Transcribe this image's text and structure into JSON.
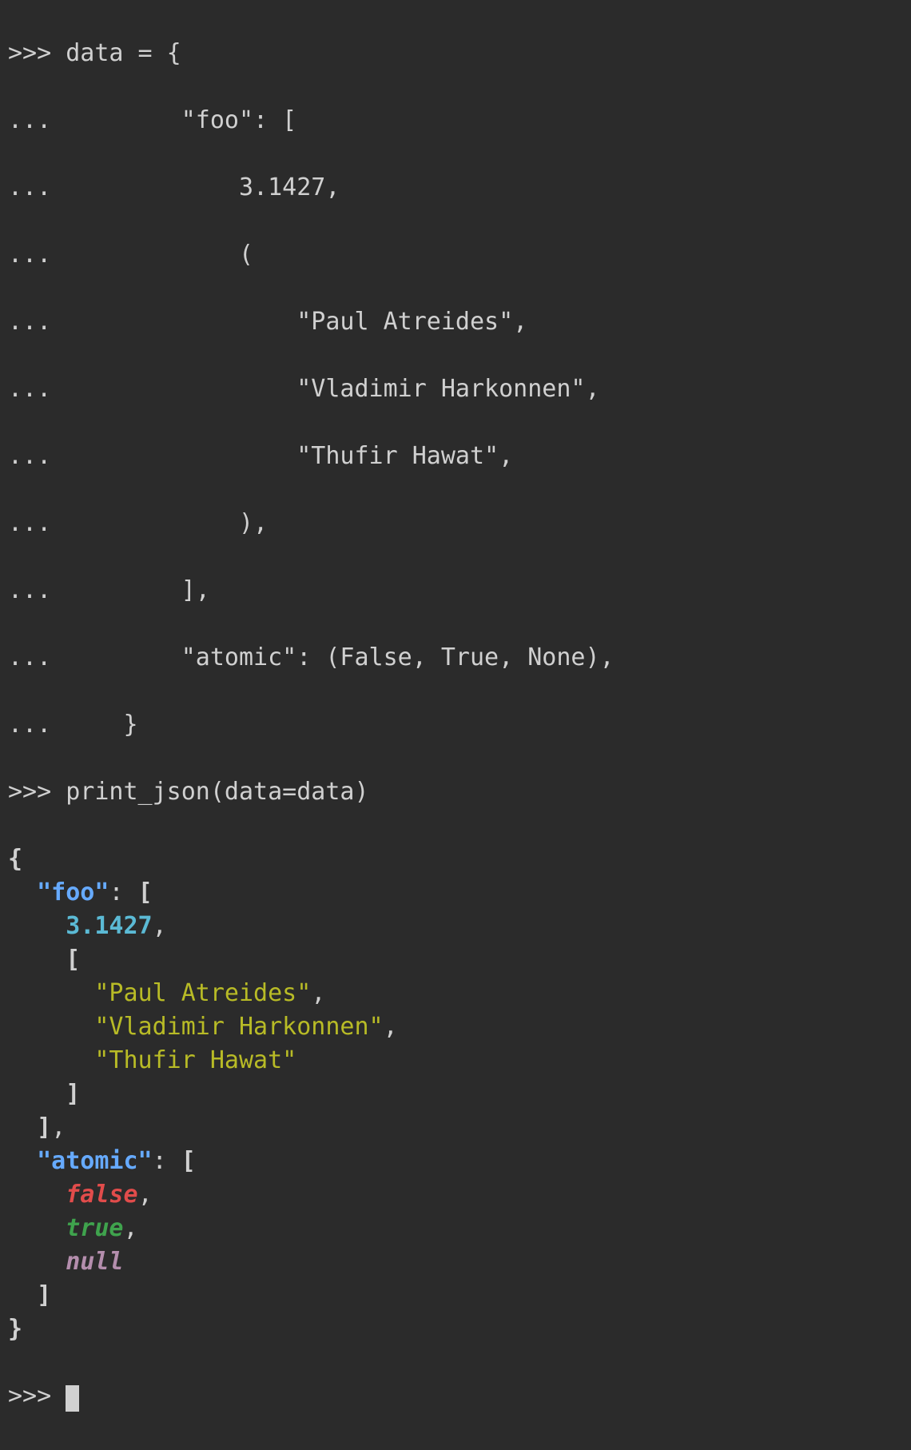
{
  "prompt_primary": ">>> ",
  "prompt_continue": "... ",
  "input_lines": [
    ">>> data = {",
    "...         \"foo\": [",
    "...             3.1427,",
    "...             (",
    "...                 \"Paul Atreides\",",
    "...                 \"Vladimir Harkonnen\",",
    "...                 \"Thufir Hawat\",",
    "...             ),",
    "...         ],",
    "...         \"atomic\": (False, True, None),",
    "...     }",
    ">>> print_json(data=data)"
  ],
  "output": {
    "tokens": [
      [
        [
          "{",
          "br"
        ]
      ],
      [
        [
          "  ",
          "g"
        ],
        [
          "\"foo\"",
          "key"
        ],
        [
          ": ",
          "g"
        ],
        [
          "[",
          "br"
        ]
      ],
      [
        [
          "    ",
          "g"
        ],
        [
          "3.1427",
          "num"
        ],
        [
          ",",
          "g"
        ]
      ],
      [
        [
          "    ",
          "g"
        ],
        [
          "[",
          "br"
        ]
      ],
      [
        [
          "      ",
          "g"
        ],
        [
          "\"Paul Atreides\"",
          "str"
        ],
        [
          ",",
          "g"
        ]
      ],
      [
        [
          "      ",
          "g"
        ],
        [
          "\"Vladimir Harkonnen\"",
          "str"
        ],
        [
          ",",
          "g"
        ]
      ],
      [
        [
          "      ",
          "g"
        ],
        [
          "\"Thufir Hawat\"",
          "str"
        ]
      ],
      [
        [
          "    ",
          "g"
        ],
        [
          "]",
          "br"
        ]
      ],
      [
        [
          "  ",
          "g"
        ],
        [
          "]",
          "br"
        ],
        [
          ",",
          "g"
        ]
      ],
      [
        [
          "  ",
          "g"
        ],
        [
          "\"atomic\"",
          "key"
        ],
        [
          ": ",
          "g"
        ],
        [
          "[",
          "br"
        ]
      ],
      [
        [
          "    ",
          "g"
        ],
        [
          "false",
          "fal"
        ],
        [
          ",",
          "g"
        ]
      ],
      [
        [
          "    ",
          "g"
        ],
        [
          "true",
          "tru"
        ],
        [
          ",",
          "g"
        ]
      ],
      [
        [
          "    ",
          "g"
        ],
        [
          "null",
          "nul"
        ]
      ],
      [
        [
          "  ",
          "g"
        ],
        [
          "]",
          "br"
        ]
      ],
      [
        [
          "}",
          "br"
        ]
      ]
    ]
  },
  "final_prompt": ">>> "
}
